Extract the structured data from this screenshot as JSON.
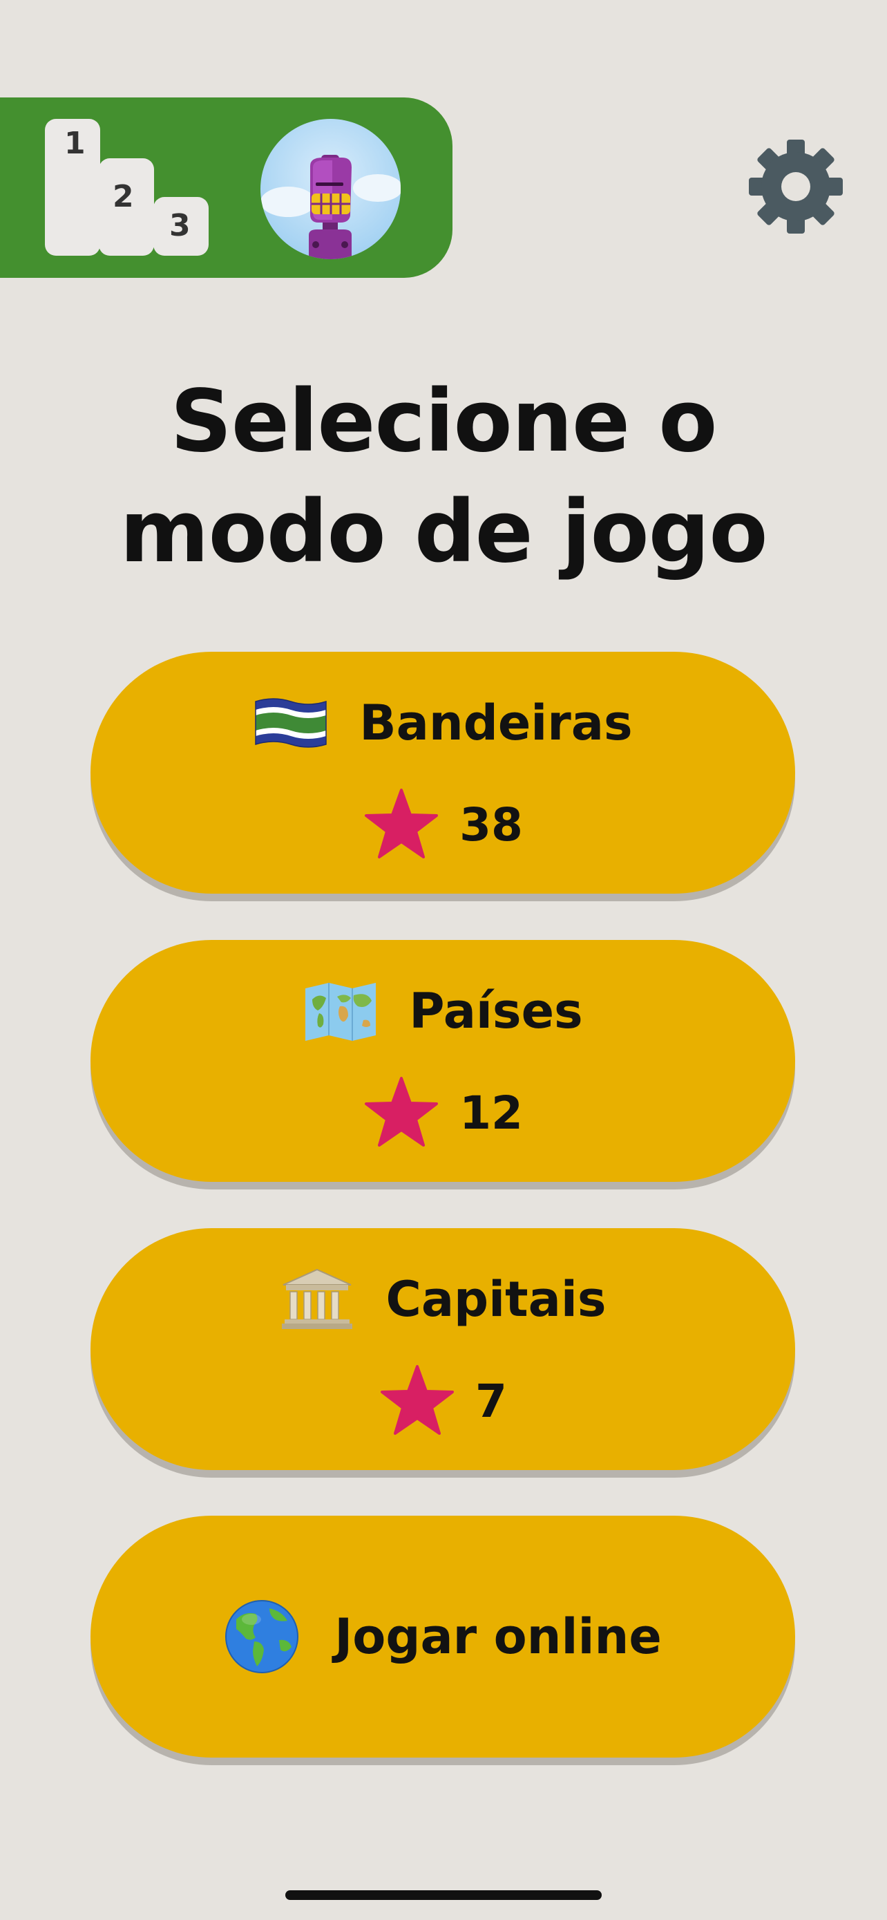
{
  "header": {
    "podium": [
      "1",
      "2",
      "3"
    ],
    "avatar_icon": "robot-avatar",
    "settings_icon": "gear-icon",
    "colors": {
      "panel": "#44902f",
      "gear": "#4b5a61"
    }
  },
  "title": {
    "line1": "Selecione o",
    "line2": "modo de jogo"
  },
  "modes": [
    {
      "label": "Bandeiras",
      "icon": "flag-icon",
      "stars": "38"
    },
    {
      "label": "Países",
      "icon": "world-map-icon",
      "stars": "12"
    },
    {
      "label": "Capitais",
      "icon": "classical-building-icon",
      "stars": "7"
    }
  ],
  "online": {
    "label": "Jogar online",
    "icon": "globe-icon"
  },
  "colors": {
    "background": "#e6e3de",
    "button": "#e8b000",
    "star": "#d81f63"
  }
}
